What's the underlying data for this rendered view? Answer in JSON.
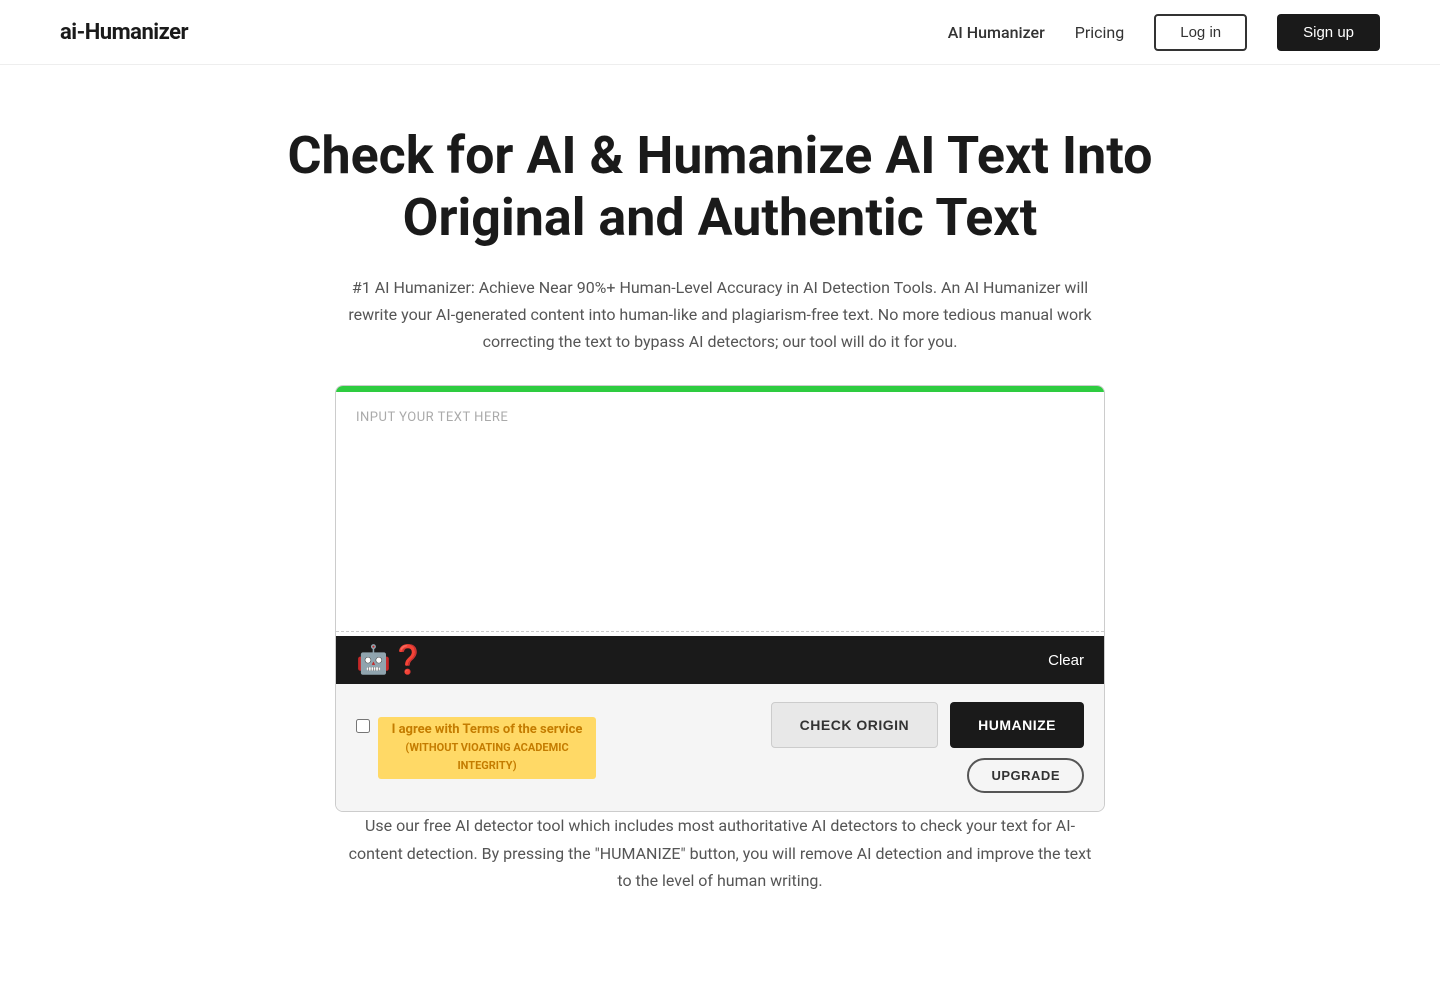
{
  "nav": {
    "logo": "ai-Humanizer",
    "links": [
      {
        "label": "AI Humanizer",
        "active": true
      },
      {
        "label": "Pricing",
        "active": false
      }
    ],
    "login_label": "Log in",
    "signup_label": "Sign up"
  },
  "hero": {
    "title_line1": "Check for AI & Humanize AI Text Into",
    "title_line2": "Original and Authentic Text",
    "description": "#1 AI Humanizer: Achieve Near 90%+ Human-Level Accuracy in AI Detection Tools. An AI Humanizer will rewrite your AI-generated content into human-like and plagiarism-free text. No more tedious manual work correcting the text to bypass AI detectors; our tool will do it for you."
  },
  "tool": {
    "textarea_placeholder": "INPUT YOUR TEXT HERE",
    "clear_label": "Clear",
    "mascot_emoji": "🤖",
    "terms_line1": "I agree with Terms of the service",
    "terms_line2": "(WITHOUT VIOATING ACADEMIC INTEGRITY)",
    "check_origin_label": "CHECK ORIGIN",
    "humanize_label": "HUMANIZE",
    "upgrade_label": "UPGRADE"
  },
  "footer_desc": "Use our free AI detector tool which includes most authoritative AI detectors to check your text for AI-content detection. By pressing the \"HUMANIZE\" button, you will remove AI detection and improve the text to the level of human writing."
}
